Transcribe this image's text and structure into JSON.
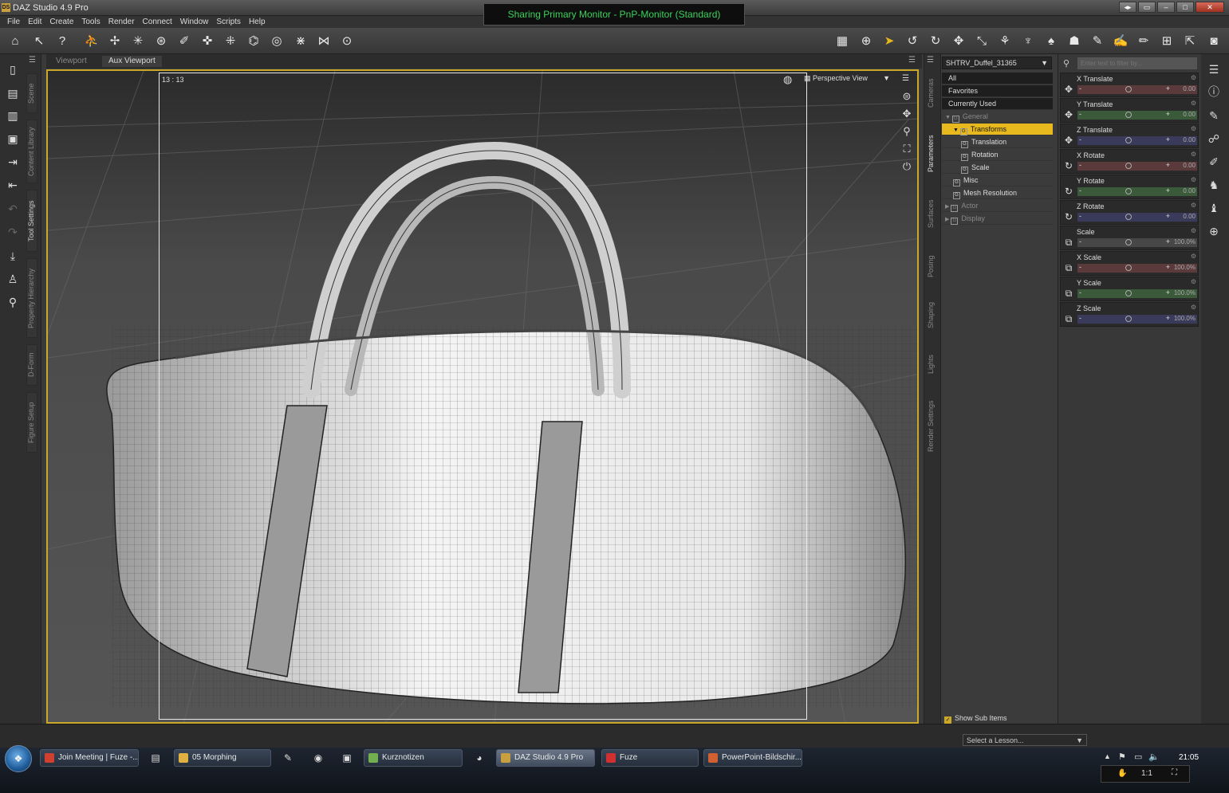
{
  "window": {
    "title": "DAZ Studio 4.9 Pro",
    "app_badge": "DS",
    "sharing_banner": "Sharing Primary Monitor - PnP-Monitor (Standard)"
  },
  "menu": [
    "File",
    "Edit",
    "Create",
    "Tools",
    "Render",
    "Connect",
    "Window",
    "Scripts",
    "Help"
  ],
  "viewport": {
    "tabs": [
      "Viewport",
      "Aux Viewport"
    ],
    "frame_info": "13 : 13",
    "view_mode": "Perspective View"
  },
  "left_tabs": [
    "Scene",
    "Content Library",
    "Tool Settings",
    "Property Hierarchy",
    "D-Form",
    "Figure Setup"
  ],
  "mid_tabs": [
    "Cameras",
    "Parameters",
    "Surfaces",
    "Posing",
    "Shaping",
    "Lights",
    "Render Settings"
  ],
  "node_selector": "SHTRV_Duffel_31365",
  "filter_placeholder": "Enter text to filter by...",
  "tree": [
    {
      "label": "All",
      "style": "dark",
      "indent": 0
    },
    {
      "label": "Favorites",
      "style": "dark",
      "indent": 0
    },
    {
      "label": "Currently Used",
      "style": "dark",
      "indent": 0
    },
    {
      "label": "General",
      "style": "dim",
      "indent": 0,
      "arrow": "▼"
    },
    {
      "label": "Transforms",
      "style": "sel",
      "indent": 1,
      "arrow": "▼"
    },
    {
      "label": "Translation",
      "style": "",
      "indent": 2
    },
    {
      "label": "Rotation",
      "style": "",
      "indent": 2
    },
    {
      "label": "Scale",
      "style": "",
      "indent": 2
    },
    {
      "label": "Misc",
      "style": "",
      "indent": 1
    },
    {
      "label": "Mesh Resolution",
      "style": "",
      "indent": 1
    },
    {
      "label": "Actor",
      "style": "dim",
      "indent": 0,
      "arrow": "▶"
    },
    {
      "label": "Display",
      "style": "dim",
      "indent": 0,
      "arrow": "▶"
    }
  ],
  "params": [
    {
      "label": "X Translate",
      "value": "0.00",
      "color": "#5a3a3a",
      "icon": "✥"
    },
    {
      "label": "Y Translate",
      "value": "0.00",
      "color": "#3a5a3a",
      "icon": "✥"
    },
    {
      "label": "Z Translate",
      "value": "0.00",
      "color": "#3a3a5a",
      "icon": "✥"
    },
    {
      "label": "X Rotate",
      "value": "0.00",
      "color": "#5a3a3a",
      "icon": "↻"
    },
    {
      "label": "Y Rotate",
      "value": "0.00",
      "color": "#3a5a3a",
      "icon": "↻"
    },
    {
      "label": "Z Rotate",
      "value": "0.00",
      "color": "#3a3a5a",
      "icon": "↻"
    },
    {
      "label": "Scale",
      "value": "100.0%",
      "color": "#474747",
      "icon": "⧉"
    },
    {
      "label": "X Scale",
      "value": "100.0%",
      "color": "#5a3a3a",
      "icon": "⧉"
    },
    {
      "label": "Y Scale",
      "value": "100.0%",
      "color": "#3a5a3a",
      "icon": "⧉"
    },
    {
      "label": "Z Scale",
      "value": "100.0%",
      "color": "#3a3a5a",
      "icon": "⧉"
    }
  ],
  "show_sub_items": "Show Sub Items",
  "lesson_select": "Select a Lesson...",
  "taskbar": {
    "tasks": [
      {
        "label": "Join Meeting | Fuze -...",
        "color": "#d04030"
      },
      {
        "label": "05 Morphing",
        "color": "#e0b040"
      },
      {
        "label": "Kurznotizen",
        "color": "#70b050"
      },
      {
        "label": "DAZ Studio 4.9 Pro",
        "color": "#c8a040"
      },
      {
        "label": "Fuze",
        "color": "#d03030"
      },
      {
        "label": "PowerPoint-Bildschir...",
        "color": "#d06030"
      }
    ],
    "clock": "21:05",
    "zoom": "1:1"
  },
  "colors": {
    "accent": "#e8b91e",
    "banner_text": "#3ad35a"
  }
}
